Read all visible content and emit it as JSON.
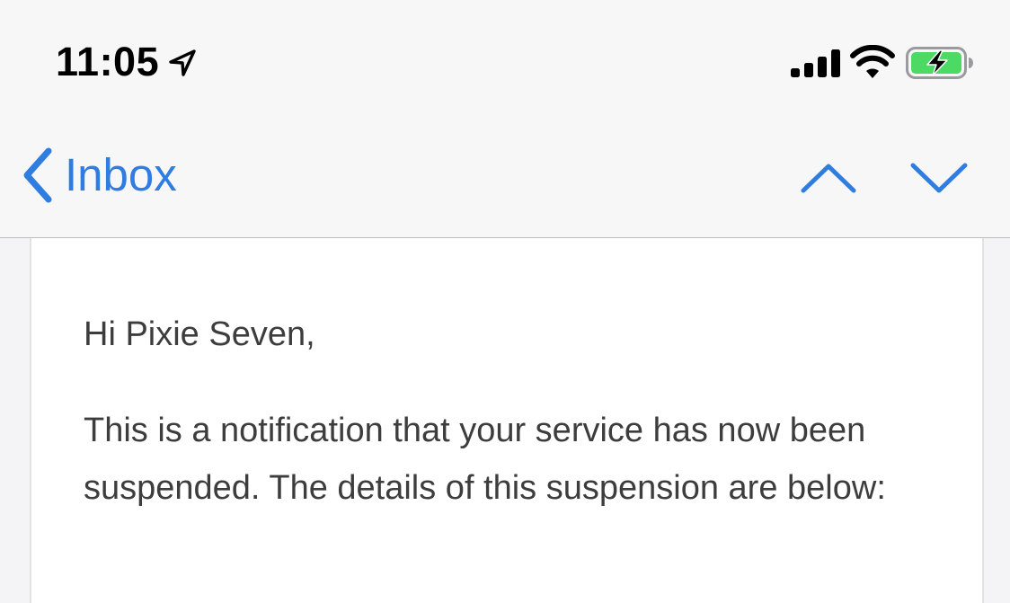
{
  "status_bar": {
    "time": "11:05",
    "location_icon": "location-arrow-icon",
    "signal_icon": "cellular-signal-icon",
    "wifi_icon": "wifi-icon",
    "battery_icon": "battery-charging-icon",
    "battery_color": "#4cd964"
  },
  "nav": {
    "back_label": "Inbox",
    "back_icon": "chevron-left-icon",
    "prev_icon": "chevron-up-icon",
    "next_icon": "chevron-down-icon",
    "accent_color": "#2f7de1"
  },
  "message": {
    "greeting": "Hi Pixie Seven,",
    "body": "This is a notification that your service has now been suspended. The details of this suspension are below:"
  }
}
